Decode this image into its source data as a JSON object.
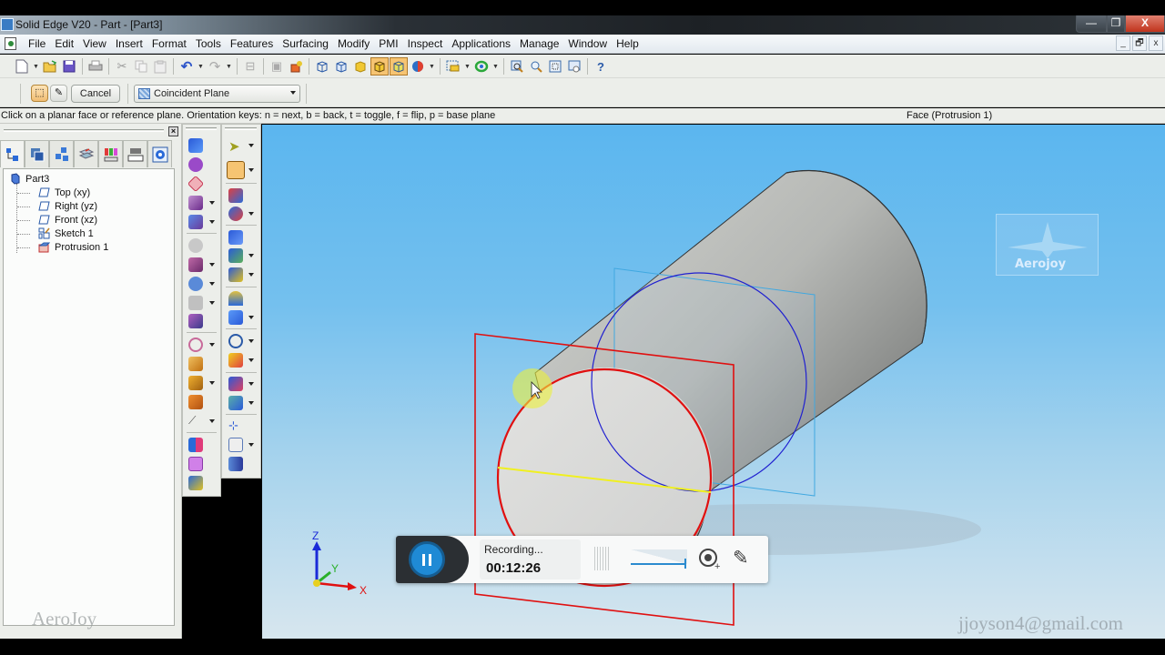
{
  "window": {
    "title": "Solid Edge V20 - Part - [Part3]",
    "controls": {
      "minimize": "—",
      "restore": "❐",
      "close": "X"
    }
  },
  "menubar": {
    "items": [
      "File",
      "Edit",
      "View",
      "Insert",
      "Format",
      "Tools",
      "Features",
      "Surfacing",
      "Modify",
      "PMI",
      "Inspect",
      "Applications",
      "Manage",
      "Window",
      "Help"
    ],
    "mdi_controls": {
      "minimize": "_",
      "restore": "🗗",
      "close": "x"
    }
  },
  "toolbar": {
    "icons": [
      "new-icon",
      "open-icon",
      "save-icon",
      "print-icon",
      "cut-icon",
      "copy-icon",
      "paste-icon",
      "undo-icon",
      "redo-icon",
      "insert-object-icon",
      "paste-special-icon",
      "object-icon",
      "wireframe-view-icon",
      "hidden-edges-icon",
      "shaded-icon",
      "shaded-edges-icon",
      "shaded-visible-edges-icon",
      "view-style-icon",
      "select-tools-icon",
      "rotate-icon",
      "zoom-area-icon",
      "zoom-icon",
      "fit-icon",
      "pan-icon",
      "whats-this-icon"
    ]
  },
  "ribbon": {
    "cancel_label": "Cancel",
    "plane_option": "Coincident Plane"
  },
  "prompt": {
    "text": "Click on a planar face or reference plane.  Orientation keys:  n = next, b = back, t = toggle, f = flip, p = base plane",
    "status": "Face (Protrusion 1)"
  },
  "edgebar": {
    "tabs": [
      "feature-pathfinder",
      "layers",
      "family-of-parts",
      "sensors",
      "feature-library",
      "engineering-reference",
      "library"
    ],
    "tree": {
      "root": "Part3",
      "items": [
        {
          "label": "Top (xy)",
          "icon": "reference-plane-icon"
        },
        {
          "label": "Right (yz)",
          "icon": "reference-plane-icon"
        },
        {
          "label": "Front (xz)",
          "icon": "reference-plane-icon"
        },
        {
          "label": "Sketch 1",
          "icon": "sketch-icon"
        },
        {
          "label": "Protrusion 1",
          "icon": "protrusion-icon"
        }
      ]
    }
  },
  "triad": {
    "x": "X",
    "y": "Y",
    "z": "Z"
  },
  "recording": {
    "status": "Recording...",
    "elapsed": "00:12:26",
    "volume_level": 0.95
  },
  "watermarks": {
    "logo_text": "Aerojoy",
    "email": "jjoyson4@gmail.com",
    "brand": "AeroJoy"
  },
  "colors": {
    "viewport_top": "#5bb6ef",
    "viewport_bottom": "#d7e6ee",
    "selected_plane": "#e01010",
    "reference_plane": "#40a8e0",
    "sketch_circle": "#2020d0",
    "highlight_edge": "#f0f020",
    "record_accent": "#1f8ad5"
  }
}
